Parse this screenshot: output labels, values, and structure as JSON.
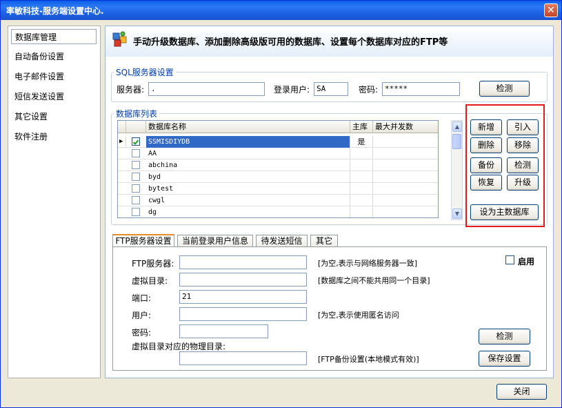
{
  "window": {
    "title": "率敏科技-服务端设置中心."
  },
  "sidebar": {
    "items": [
      {
        "label": "数据库管理"
      },
      {
        "label": "自动备份设置"
      },
      {
        "label": "电子邮件设置"
      },
      {
        "label": "短信发送设置"
      },
      {
        "label": "其它设置"
      },
      {
        "label": "软件注册"
      }
    ]
  },
  "banner": {
    "text": "手动升级数据库、添加删除高级版可用的数据库、设置每个数据库对应的FTP等"
  },
  "sql": {
    "legend": "SQL服务器设置",
    "server_label": "服务器:",
    "server_value": ".",
    "user_label": "登录用户:",
    "user_value": "SA",
    "password_label": "密码:",
    "password_value": "*****",
    "check_button": "检测"
  },
  "dblist": {
    "legend": "数据库列表",
    "columns": [
      "数据库名称",
      "主库",
      "最大并发数"
    ],
    "rows": [
      {
        "name": "SSMISDIYDB",
        "main": "是",
        "max": ""
      },
      {
        "name": "AA",
        "main": "",
        "max": ""
      },
      {
        "name": "abchina",
        "main": "",
        "max": ""
      },
      {
        "name": "byd",
        "main": "",
        "max": ""
      },
      {
        "name": "bytest",
        "main": "",
        "max": ""
      },
      {
        "name": "cwgl",
        "main": "",
        "max": ""
      },
      {
        "name": "dg",
        "main": "",
        "max": ""
      }
    ],
    "selected_marker": "▶"
  },
  "actions": {
    "add": "新增",
    "import": "引入",
    "delete": "删除",
    "remove": "移除",
    "backup": "备份",
    "check": "检测",
    "restore": "恢复",
    "upgrade": "升级",
    "set_main": "设为主数据库"
  },
  "tabs": [
    {
      "label": "FTP服务器设置"
    },
    {
      "label": "当前登录用户信息"
    },
    {
      "label": "待发送短信"
    },
    {
      "label": "其它"
    }
  ],
  "ftp": {
    "server_label": "FTP服务器:",
    "server_value": "",
    "server_hint": "[为空,表示与网络服务器一致]",
    "vdir_label": "虚拟目录:",
    "vdir_value": "",
    "vdir_hint": "[数据库之间不能共用同一个目录]",
    "port_label": "端口:",
    "port_value": "21",
    "user_label": "用户:",
    "user_value": "",
    "user_hint": "[为空,表示使用匿名访问",
    "password_label": "密码:",
    "password_value": "",
    "physdir_label": "虚拟目录对应的物理目录:",
    "physdir_value": "",
    "physdir_hint": "[FTP备份设置(本地模式有效)]",
    "enable_label": "启用",
    "check_button": "检测",
    "save_button": "保存设置"
  },
  "footer": {
    "close_button": "关闭"
  }
}
